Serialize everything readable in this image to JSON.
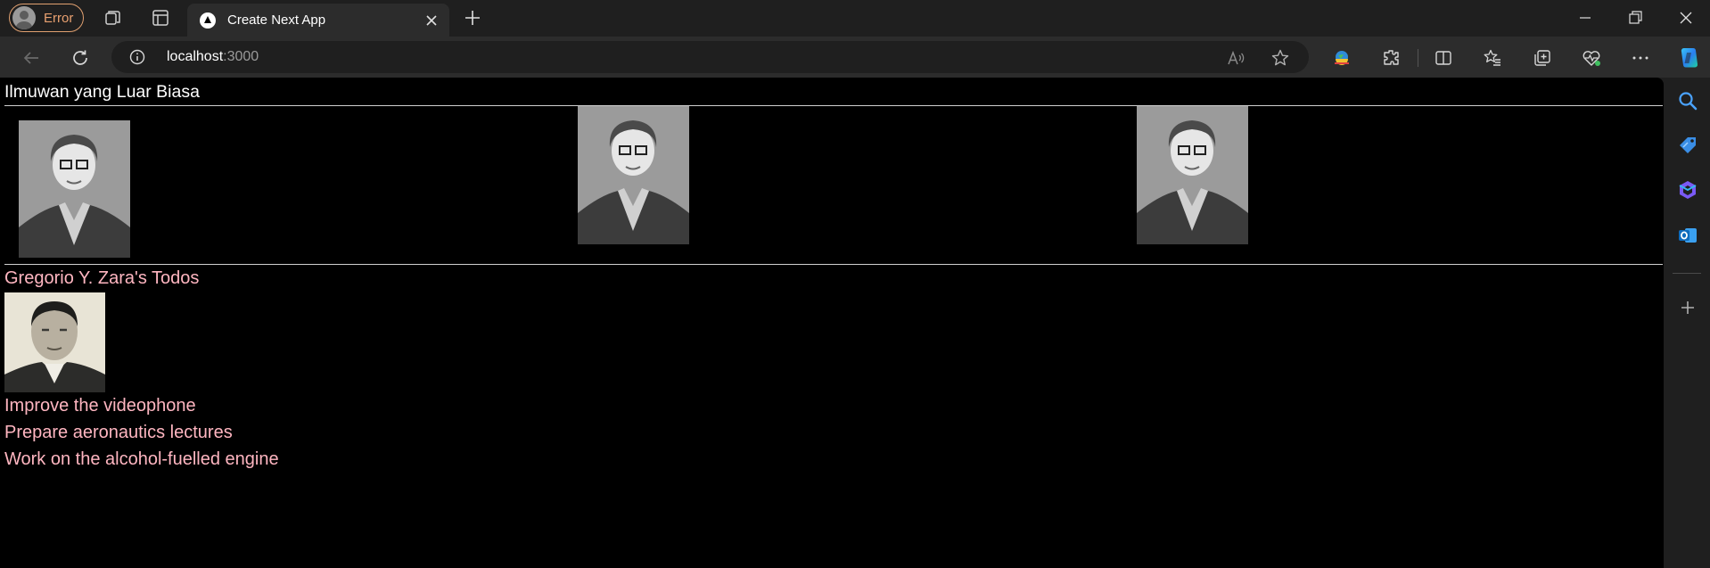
{
  "browser": {
    "profile_label": "Error",
    "tab_title": "Create Next App",
    "url_host": "localhost",
    "url_port": ":3000",
    "icons": [
      "workspaces-icon",
      "tab-actions-icon",
      "back-icon",
      "refresh-icon",
      "site-info-icon",
      "read-aloud-icon",
      "favorite-icon",
      "extensions-icon",
      "split-screen-icon",
      "favorites-icon",
      "collections-icon",
      "browser-essentials-icon",
      "more-icon",
      "copilot-icon"
    ]
  },
  "sidebar": {
    "icons": [
      "search-icon",
      "shopping-tag-icon",
      "microsoft-365-icon",
      "outlook-icon",
      "add-icon"
    ]
  },
  "page": {
    "heading": "Ilmuwan yang Luar Biasa",
    "gallery": [
      "Katherine Johnson photo",
      "Katherine Johnson photo",
      "Katherine Johnson photo"
    ],
    "profile_heading": "Gregorio Y. Zara's Todos",
    "profile_photo": "Gregorio Y. Zara portrait",
    "todos": [
      "Improve the videophone",
      "Prepare aeronautics lectures",
      "Work on the alcohol-fuelled engine"
    ],
    "colors": {
      "todo_text": "#ffb6c1",
      "heading_text": "#ffffff",
      "background": "#000000"
    }
  }
}
